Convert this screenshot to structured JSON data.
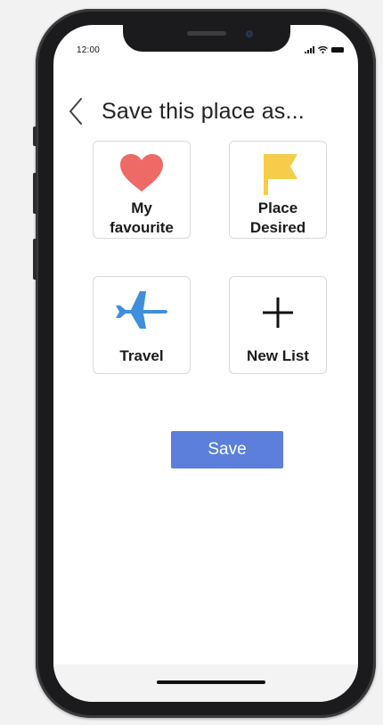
{
  "status_bar": {
    "time": "12:00"
  },
  "header": {
    "title": "Save this place as..."
  },
  "options": [
    {
      "label": "My\nfavourite",
      "icon": "heart-icon",
      "color": "#ee6a66"
    },
    {
      "label": "Place\nDesired",
      "icon": "flag-icon",
      "color": "#f5cd4a"
    },
    {
      "label": "Travel",
      "icon": "airplane-icon",
      "color": "#3f8fdc"
    },
    {
      "label": "New List",
      "icon": "plus-icon",
      "color": "#111111"
    }
  ],
  "actions": {
    "save_label": "Save"
  },
  "colors": {
    "accent": "#5b7fdb",
    "heart": "#ee6a66",
    "flag": "#f5cd4a",
    "plane": "#3f8fdc"
  }
}
